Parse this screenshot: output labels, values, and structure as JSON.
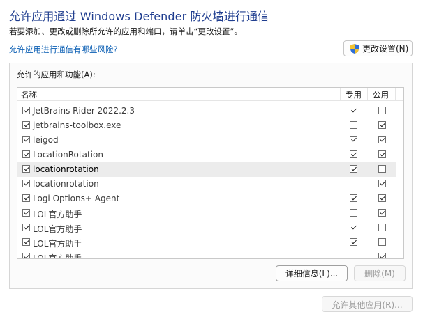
{
  "header": {
    "title": "允许应用通过 Windows Defender 防火墙进行通信",
    "subtitle": "若要添加、更改或删除所允许的应用和端口，请单击“更改设置”。",
    "risk_link": "允许应用进行通信有哪些风险?",
    "change_settings_label": "更改设置(N)"
  },
  "group": {
    "label": "允许的应用和功能(A):",
    "columns": {
      "name": "名称",
      "private": "专用",
      "public": "公用"
    },
    "rows": [
      {
        "label": "JetBrains Rider 2022.2.3",
        "enabled": true,
        "private": true,
        "public": false,
        "selected": false
      },
      {
        "label": "jetbrains-toolbox.exe",
        "enabled": true,
        "private": false,
        "public": true,
        "selected": false
      },
      {
        "label": "leigod",
        "enabled": true,
        "private": true,
        "public": true,
        "selected": false
      },
      {
        "label": "LocationRotation",
        "enabled": true,
        "private": true,
        "public": true,
        "selected": false
      },
      {
        "label": "locationrotation",
        "enabled": true,
        "private": true,
        "public": false,
        "selected": true
      },
      {
        "label": "locationrotation",
        "enabled": true,
        "private": false,
        "public": true,
        "selected": false
      },
      {
        "label": "Logi Options+ Agent",
        "enabled": true,
        "private": true,
        "public": true,
        "selected": false
      },
      {
        "label": "LOL官方助手",
        "enabled": true,
        "private": false,
        "public": true,
        "selected": false
      },
      {
        "label": "LOL官方助手",
        "enabled": true,
        "private": true,
        "public": false,
        "selected": false
      },
      {
        "label": "LOL官方助手",
        "enabled": true,
        "private": true,
        "public": false,
        "selected": false
      },
      {
        "label": "LOL官方助手",
        "enabled": true,
        "private": false,
        "public": true,
        "selected": false
      }
    ],
    "details_label": "详细信息(L)...",
    "delete_label": "删除(M)"
  },
  "footer": {
    "allow_other_label": "允许其他应用(R)..."
  }
}
